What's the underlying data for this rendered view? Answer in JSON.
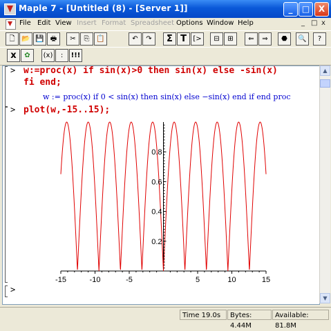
{
  "window": {
    "title": "Maple 7 - [Untitled (8) - [Server 1]]",
    "minimize_label": "_",
    "maximize_label": "□",
    "close_label": "X"
  },
  "menu": {
    "items": [
      {
        "label": "File",
        "enabled": true
      },
      {
        "label": "Edit",
        "enabled": true
      },
      {
        "label": "View",
        "enabled": true
      },
      {
        "label": "Insert",
        "enabled": false
      },
      {
        "label": "Format",
        "enabled": false
      },
      {
        "label": "Spreadsheet",
        "enabled": false
      },
      {
        "label": "Options",
        "enabled": true
      },
      {
        "label": "Window",
        "enabled": true
      },
      {
        "label": "Help",
        "enabled": true
      }
    ],
    "doc_controls": [
      "_",
      "□",
      "x"
    ]
  },
  "toolbar1": {
    "buttons": [
      {
        "name": "new-document-icon",
        "glyph": "🗋"
      },
      {
        "name": "open-icon",
        "glyph": "📂"
      },
      {
        "name": "save-icon",
        "glyph": "💾"
      },
      {
        "name": "print-icon",
        "glyph": "🖶"
      },
      {
        "name": "cut-icon",
        "glyph": "✂"
      },
      {
        "name": "copy-icon",
        "glyph": "⎘"
      },
      {
        "name": "paste-icon",
        "glyph": "📋"
      },
      {
        "name": "undo-icon",
        "glyph": "↶"
      },
      {
        "name": "redo-icon",
        "glyph": "↷"
      },
      {
        "name": "sum-icon",
        "glyph": "Σ"
      },
      {
        "name": "text-mode-icon",
        "glyph": "T"
      },
      {
        "name": "insert-prompt-icon",
        "glyph": "[>"
      },
      {
        "name": "split-section-icon",
        "glyph": "⊟"
      },
      {
        "name": "join-section-icon",
        "glyph": "⊞"
      },
      {
        "name": "back-arrow-icon",
        "glyph": "⇐"
      },
      {
        "name": "forward-arrow-icon",
        "glyph": "⇒"
      },
      {
        "name": "stop-icon",
        "glyph": "⬣"
      },
      {
        "name": "zoom-icon",
        "glyph": "🔍"
      },
      {
        "name": "help-icon",
        "glyph": "?"
      }
    ]
  },
  "toolbar2": {
    "buttons": [
      {
        "name": "math-mode-icon",
        "glyph": "x"
      },
      {
        "name": "maple-leaf-icon",
        "glyph": "✿"
      },
      {
        "name": "parentheses-icon",
        "glyph": "(x)"
      },
      {
        "name": "colon-icon",
        "glyph": ":"
      },
      {
        "name": "execute-all-icon",
        "glyph": "!!!"
      }
    ]
  },
  "worksheet": {
    "prompt_symbol": ">",
    "input1_line1": "w:=proc(x) if sin(x)>0 then sin(x) else -sin(x)",
    "input1_line2": "fi end;",
    "output1": "w := proc(x) if 0 < sin(x) then sin(x) else −sin(x) end if end proc",
    "input2": "plot(w,-15..15);",
    "empty_prompt": ">"
  },
  "chart_data": {
    "type": "line",
    "function": "|sin(x)|",
    "xlim": [
      -15,
      15
    ],
    "ylim": [
      0,
      1
    ],
    "x_ticks": [
      "-15",
      "-10",
      "-5",
      "5",
      "10",
      "15"
    ],
    "y_ticks": [
      "0.2",
      "0.4",
      "0.6",
      "0.8"
    ],
    "y_tick_values": [
      0.2,
      0.4,
      0.6,
      0.8
    ],
    "x_tick_values": [
      -15,
      -10,
      -5,
      5,
      10,
      15
    ],
    "line_color": "#e00000",
    "grid": false
  },
  "status": {
    "time": "Time  19.0s",
    "bytes": "Bytes: 4.44M",
    "available": "Available: 81.8M"
  }
}
